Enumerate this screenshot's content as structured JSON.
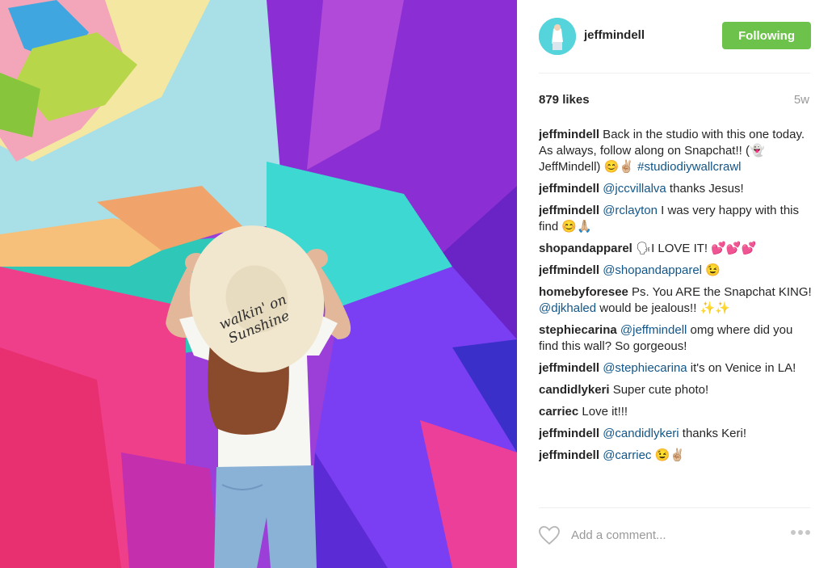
{
  "post": {
    "username": "jeffmindell",
    "follow_label": "Following",
    "likes": "879 likes",
    "age": "5w",
    "add_comment_placeholder": "Add a comment..."
  },
  "comments": [
    {
      "user": "jeffmindell",
      "pre": " Back in the studio with this one today. As always, follow along on Snapchat!! (👻 JeffMindell) 😊✌🏼 ",
      "link": "#studiodiywallcrawl",
      "post": ""
    },
    {
      "user": "jeffmindell",
      "pre": " ",
      "link": "@jccvillalva",
      "post": " thanks Jesus!"
    },
    {
      "user": "jeffmindell",
      "pre": " ",
      "link": "@rclayton",
      "post": " I was very happy with this find 😊🙏🏼"
    },
    {
      "user": "shopandapparel",
      "pre": " 🗣I LOVE IT! 💕💕💕",
      "link": "",
      "post": ""
    },
    {
      "user": "jeffmindell",
      "pre": " ",
      "link": "@shopandapparel",
      "post": " 😉"
    },
    {
      "user": "homebyforesee",
      "pre": " Ps. You ARE the Snapchat KING! ",
      "link": "@djkhaled",
      "post": " would be jealous!! ✨✨"
    },
    {
      "user": "stephiecarina",
      "pre": " ",
      "link": "@jeffmindell",
      "post": " omg where did you find this wall? So gorgeous!"
    },
    {
      "user": "jeffmindell",
      "pre": " ",
      "link": "@stephiecarina",
      "post": " it's on Venice in LA!"
    },
    {
      "user": "candidlykeri",
      "pre": " Super cute photo!",
      "link": "",
      "post": ""
    },
    {
      "user": "carriec",
      "pre": " Love it!!!",
      "link": "",
      "post": ""
    },
    {
      "user": "jeffmindell",
      "pre": " ",
      "link": "@candidlykeri",
      "post": " thanks Keri!"
    },
    {
      "user": "jeffmindell",
      "pre": " ",
      "link": "@carriec",
      "post": " 😉✌🏼"
    }
  ],
  "photo": {
    "hat_text": "walkin' on Sunshine"
  },
  "colors": {
    "follow_green": "#6cc24a",
    "link_blue": "#125688"
  },
  "icons": [
    "heart-icon",
    "more-options-icon"
  ]
}
